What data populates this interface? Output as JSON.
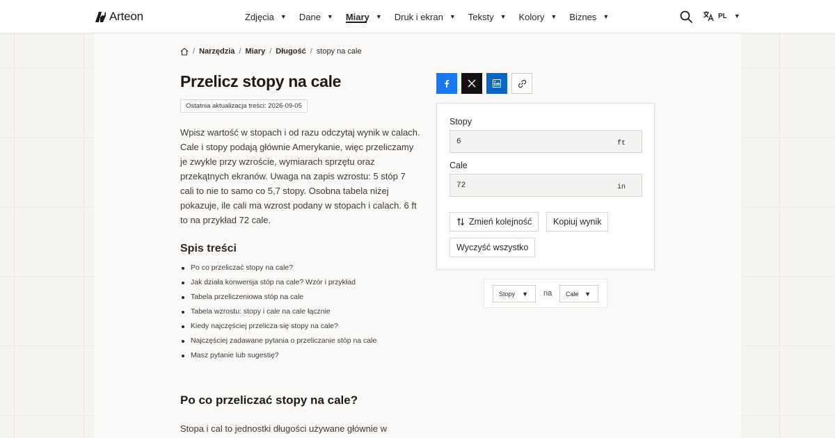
{
  "brand": {
    "name": "Arteon"
  },
  "nav": {
    "items": [
      {
        "label": "Zdjęcia"
      },
      {
        "label": "Dane"
      },
      {
        "label": "Miary"
      },
      {
        "label": "Druk i ekran"
      },
      {
        "label": "Teksty"
      },
      {
        "label": "Kolory"
      },
      {
        "label": "Biznes"
      }
    ],
    "active": "Miary",
    "language": "PL"
  },
  "breadcrumb": {
    "items": [
      "Narzędzia",
      "Miary",
      "Długość"
    ],
    "current": "stopy na cale"
  },
  "page": {
    "title": "Przelicz stopy na cale",
    "updated": "Ostatnia aktualizacja treści: 2026-09-05",
    "intro": "Wpisz wartość w stopach i od razu odczytaj wynik w calach. Cale i stopy podają głównie Amerykanie, więc przeliczamy je zwykle przy wzroście, wymiarach sprzętu oraz przekątnych ekranów. Uwaga na zapis wzrostu: 5 stóp 7 cali to nie to samo co 5,7 stopy. Osobna tabela niżej pokazuje, ile cali ma wzrost podany w stopach i calach. 6 ft to na przykład 72 cale."
  },
  "toc": {
    "title": "Spis treści",
    "items": [
      "Po co przeliczać stopy na cale?",
      "Jak działa konwersja stóp na cale? Wzór i przykład",
      "Tabela przeliczeniowa stóp na cale",
      "Tabela wzrostu: stopy i cale na cale łącznie",
      "Kiedy najczęściej przelicza się stopy na cale?",
      "Najczęściej zadawane pytania o przeliczanie stóp na cale",
      "Masz pytanie lub sugestię?"
    ]
  },
  "section": {
    "title": "Po co przeliczać stopy na cale?",
    "text": "Stopa i cal to jednostki długości używane głównie w"
  },
  "share": {
    "icons": [
      "facebook-icon",
      "x-icon",
      "linkedin-icon",
      "link-icon"
    ]
  },
  "converter": {
    "from": {
      "label": "Stopy",
      "value": "6",
      "unit": "ft"
    },
    "to": {
      "label": "Cale",
      "value": "72",
      "unit": "in"
    },
    "buttons": {
      "swap": "Zmień kolejność",
      "copy": "Kopiuj wynik",
      "clear": "Wyczyść wszystko"
    }
  },
  "unit_select": {
    "from": "Stopy",
    "connector": "na",
    "to": "Cale"
  },
  "colors": {
    "facebook": "#1877f2",
    "x": "#141110",
    "linkedin": "#0a66c2"
  }
}
